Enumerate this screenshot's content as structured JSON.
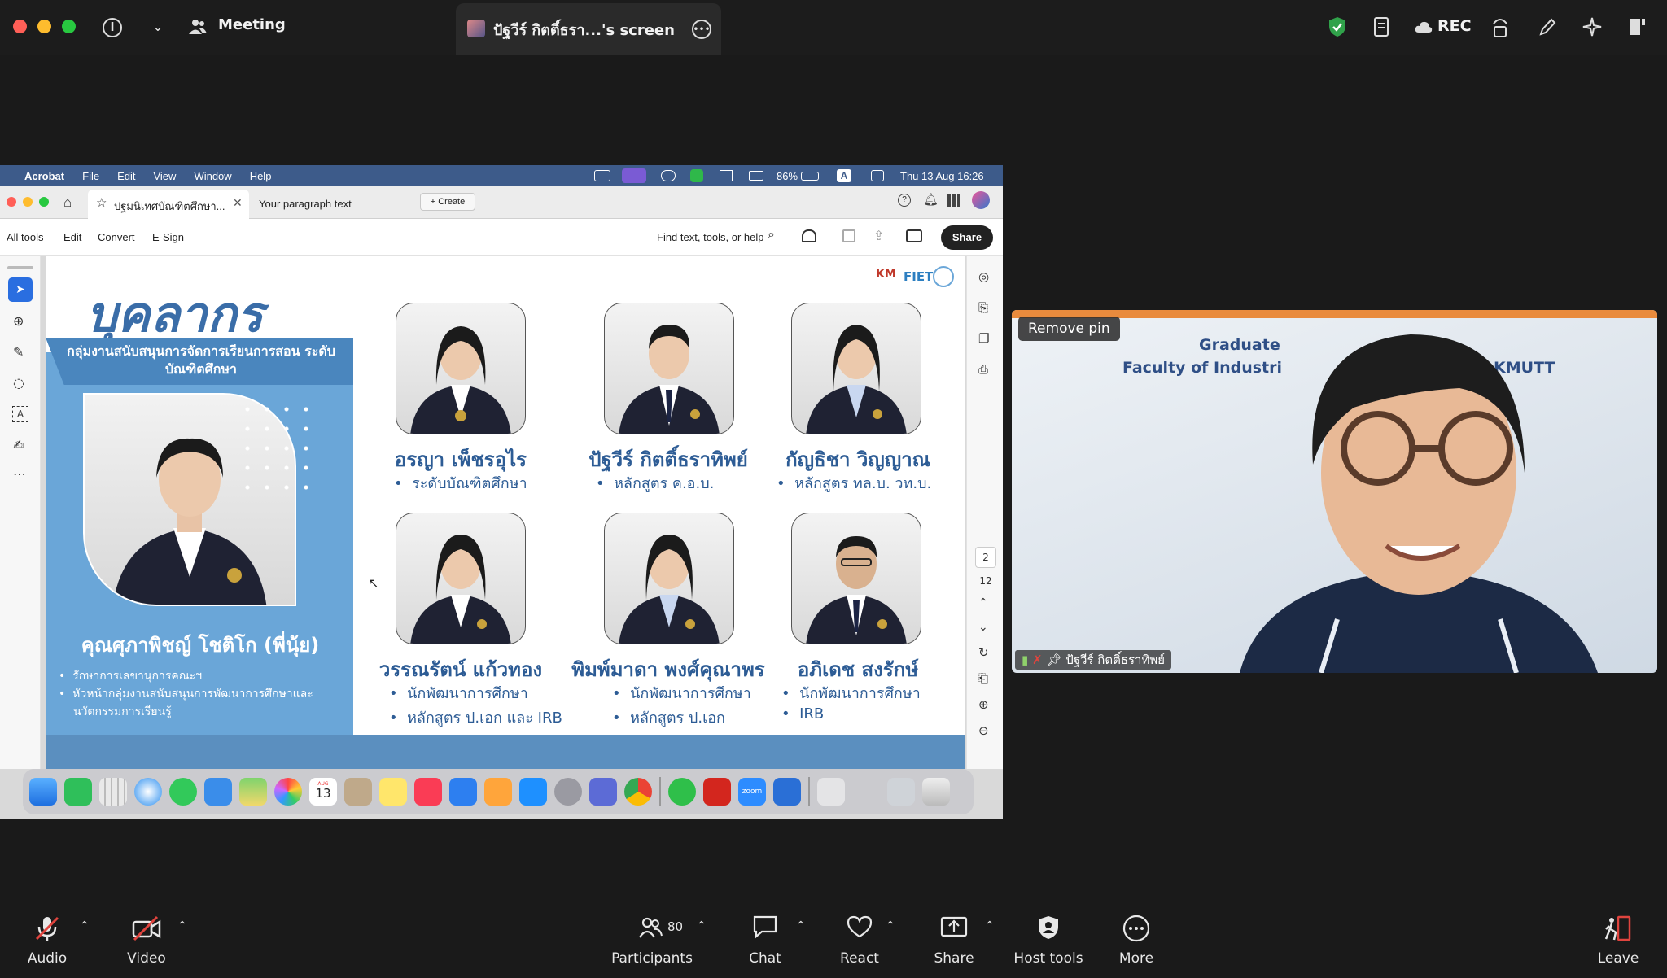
{
  "zoom_top": {
    "meeting_label": "Meeting",
    "screen_tab_label": "ปัฐวีร์ กิตติ์ธรา...'s screen",
    "rec_label": "REC"
  },
  "mac_menubar": {
    "items": [
      "Acrobat",
      "File",
      "Edit",
      "View",
      "Window",
      "Help"
    ],
    "battery": "86%",
    "input_source": "A",
    "datetime": "Thu 13 Aug  16:26"
  },
  "acrobat": {
    "tab1": "ปฐมนิเทศบัณฑิตศึกษา...",
    "tab2": "Your paragraph text",
    "create_label": "Create",
    "toolbar": [
      "All tools",
      "Edit",
      "Convert",
      "E-Sign"
    ],
    "find_label": "Find text, tools, or help",
    "share_label": "Share",
    "page_current": "2",
    "page_total": "12"
  },
  "slide": {
    "title": "บุคลากร",
    "banner": "กลุ่มงานสนับสนุนการจัดการเรียนการสอน ระดับบัณฑิตศึกษา",
    "logo_text": "FIET",
    "main": {
      "name": "คุณศุภาพิชญ์ โชติโก (พี่นุ้ย)",
      "bullets": [
        "รักษาการเลขานุการคณะฯ",
        "หัวหน้ากลุ่มงานสนับสนุนการพัฒนาการศึกษาและ",
        "นวัตกรรมการเรียนรู้"
      ]
    },
    "staff": [
      {
        "name": "อรญา เพ็ชรอุไร",
        "details": [
          "ระดับบัณฑิตศึกษา"
        ]
      },
      {
        "name": "ปัฐวีร์ กิตติ์ธราทิพย์",
        "details": [
          "หลักสูตร ค.อ.บ."
        ]
      },
      {
        "name": "กัญธิชา วิญญาณ",
        "details": [
          "หลักสูตร ทล.บ. วท.บ."
        ]
      },
      {
        "name": "วรรณรัตน์ แก้วทอง",
        "details": [
          "นักพัฒนาการศึกษา",
          "หลักสูตร ป.เอก และ IRB"
        ]
      },
      {
        "name": "พิมพ์มาดา พงศ์คุณาพร",
        "details": [
          "นักพัฒนาการศึกษา",
          "หลักสูตร ป.เอก"
        ]
      },
      {
        "name": "อภิเดช สงรักษ์",
        "details": [
          "นักพัฒนาการศึกษา",
          "IRB"
        ]
      }
    ]
  },
  "dock": {
    "calendar_day": "13",
    "calendar_month": "AUG",
    "zoom_label": "zoom"
  },
  "video": {
    "remove_pin": "Remove pin",
    "participant_name": "ปัฐวีร์ กิตติ์ธราทิพย์",
    "background_text_1": "Graduate",
    "background_text_2": "Faculty of Industri",
    "background_text_3": "KMUTT"
  },
  "bottom_bar": {
    "audio": "Audio",
    "video": "Video",
    "participants": "Participants",
    "participants_count": "80",
    "chat": "Chat",
    "react": "React",
    "share": "Share",
    "host_tools": "Host tools",
    "more": "More",
    "leave": "Leave"
  },
  "colors": {
    "slide_blue": "#3a6da8",
    "panel_blue": "#6aa6d8",
    "share_green": "#30a24a",
    "muted_red": "#e0443e"
  }
}
